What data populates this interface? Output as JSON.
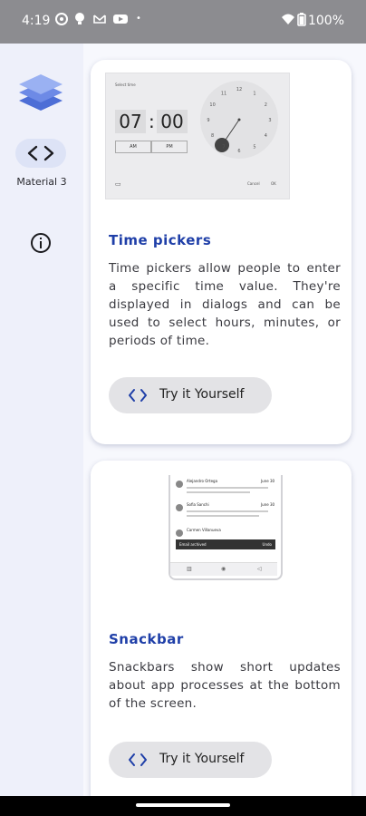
{
  "status_bar": {
    "time": "4:19",
    "battery": "100%"
  },
  "rail": {
    "logo_icon": "layers-icon",
    "active_item_icon": "code-icon",
    "active_item_label": "Material 3",
    "info_icon": "info-icon"
  },
  "cards": [
    {
      "title": "Time pickers",
      "description": "Time pickers allow people to enter a specific time value. They're displayed in dialogs and can be used to select hours, minutes, or periods of time.",
      "button_label": "Try it Yourself",
      "thumbnail": {
        "header": "Select time",
        "hour": "07",
        "minute": "00",
        "am": "AM",
        "pm": "PM",
        "cancel": "Cancel",
        "ok": "OK",
        "dial_numbers": [
          "12",
          "1",
          "2",
          "3",
          "4",
          "5",
          "6",
          "7",
          "8",
          "9",
          "10",
          "11"
        ]
      }
    },
    {
      "title": "Snackbar",
      "description": "Snackbars show short updates about app processes at the bottom of the screen.",
      "button_label": "Try it Yourself",
      "thumbnail": {
        "rows": [
          {
            "name": "Alejandro Ortega",
            "date": "June 30"
          },
          {
            "name": "Sofia Sanchi",
            "date": "June 30"
          },
          {
            "name": "Carmen Villanueva",
            "date": ""
          }
        ],
        "snackbar_text": "Email archived",
        "snackbar_action": "Undo"
      }
    }
  ],
  "colors": {
    "accent": "#1f3fa8",
    "rail_bg": "#eef0fa",
    "status_bar": "#8c8c90"
  }
}
